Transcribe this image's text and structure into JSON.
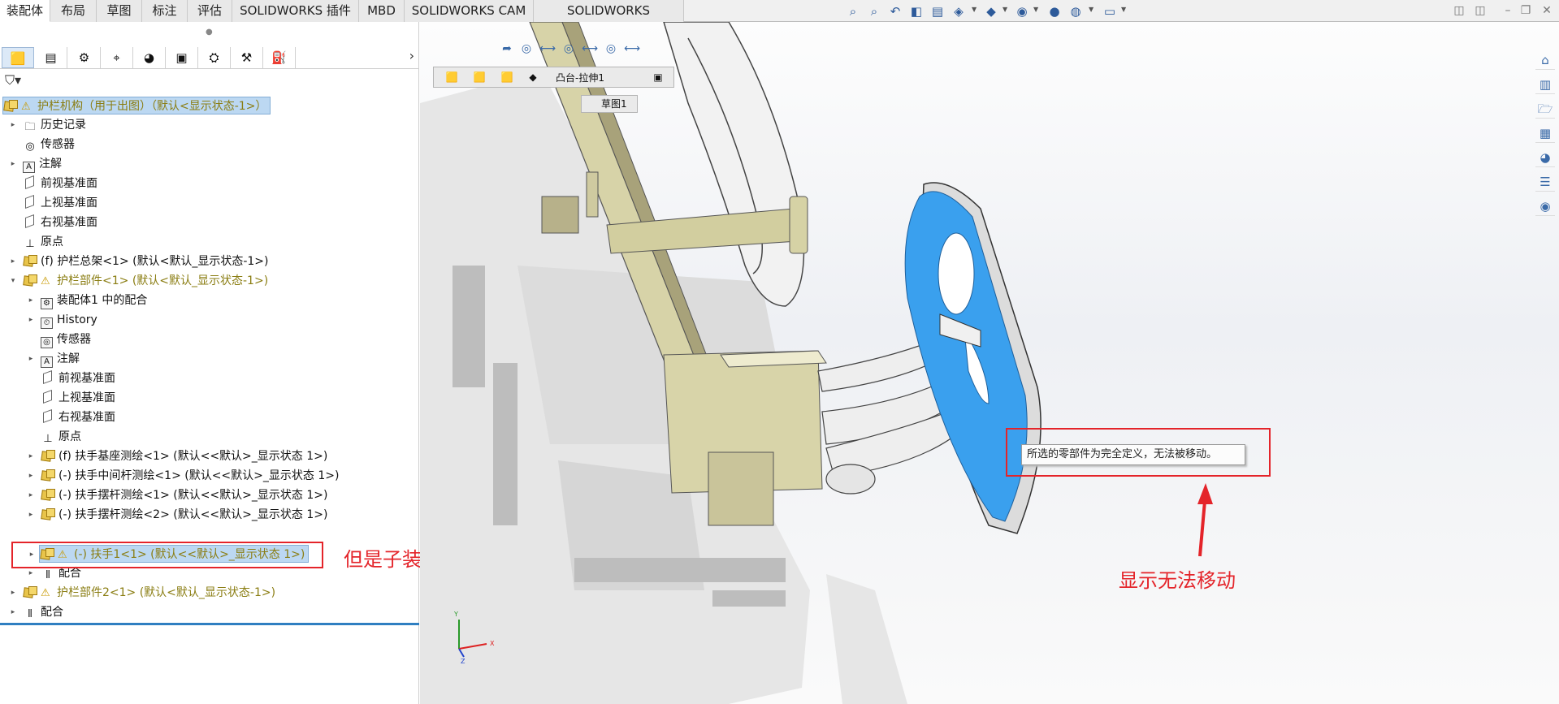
{
  "tabs": [
    "装配体",
    "布局",
    "草图",
    "标注",
    "评估",
    "SOLIDWORKS 插件",
    "MBD",
    "SOLIDWORKS CAM",
    "SOLIDWORKS Inspection"
  ],
  "tree": {
    "root": "护栏机构（用于出图）（默认<显示状态-1>）",
    "items": [
      {
        "label": "历史记录"
      },
      {
        "label": "传感器"
      },
      {
        "label": "注解"
      },
      {
        "label": "前视基准面"
      },
      {
        "label": "上视基准面"
      },
      {
        "label": "右视基准面"
      },
      {
        "label": "原点"
      },
      {
        "label": "(f) 护栏总架<1> (默认<默认_显示状态-1>)"
      },
      {
        "label": "护栏部件<1> (默认<默认_显示状态-1>)"
      },
      {
        "label": "装配体1 中的配合"
      },
      {
        "label": "History"
      },
      {
        "label": "传感器"
      },
      {
        "label": "注解"
      },
      {
        "label": "前视基准面"
      },
      {
        "label": "上视基准面"
      },
      {
        "label": "右视基准面"
      },
      {
        "label": "原点"
      },
      {
        "label": "(f) 扶手基座测绘<1> (默认<<默认>_显示状态 1>)"
      },
      {
        "label": "(-) 扶手中间杆测绘<1> (默认<<默认>_显示状态 1>)"
      },
      {
        "label": "(-) 扶手摆杆测绘<1> (默认<<默认>_显示状态 1>)"
      },
      {
        "label": "(-) 扶手摆杆测绘<2> (默认<<默认>_显示状态 1>)"
      },
      {
        "label": "(-) 扶手1<1> (默认<<默认>_显示状态 1>)"
      },
      {
        "label": "配合"
      },
      {
        "label": "护栏部件2<1> (默认<默认_显示状态-1>)"
      },
      {
        "label": "配合"
      }
    ]
  },
  "breadcrumb": {
    "feature": "凸台-拉伸1",
    "sketch": "草图1"
  },
  "tooltip": "所选的零部件为完全定义，无法被移动。",
  "annotations": {
    "subassembly_note": "但是子装配体并没有被完全定义",
    "move_note": "显示无法移动"
  },
  "triad": {
    "x": "X",
    "y": "Y",
    "z": "Z"
  },
  "colors": {
    "accent": "#e4242a",
    "selection": "#bcd8f2",
    "highlight_face": "#3aa0ee"
  }
}
